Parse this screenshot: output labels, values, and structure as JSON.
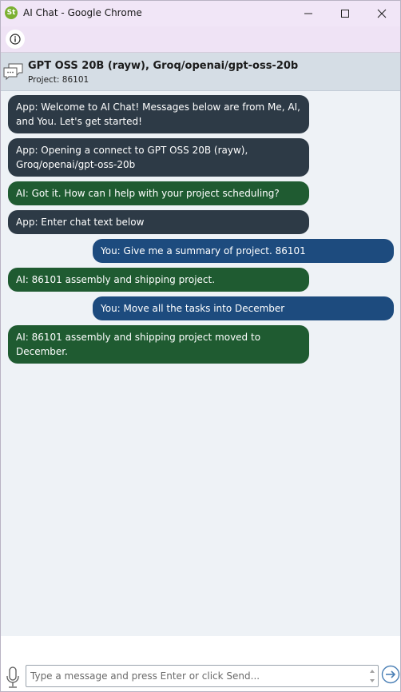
{
  "window": {
    "title": "AI Chat - Google Chrome",
    "app_icon_text": "St"
  },
  "header": {
    "title": "GPT OSS 20B (rayw), Groq/openai/gpt-oss-20b",
    "subtitle": "Project: 86101"
  },
  "messages": [
    {
      "sender": "app",
      "text": "App: Welcome to AI Chat! Messages below are from Me, AI, and You. Let's get started!"
    },
    {
      "sender": "app",
      "text": "App: Opening a connect to GPT OSS 20B (rayw), Groq/openai/gpt-oss-20b"
    },
    {
      "sender": "ai",
      "text": "AI: Got it. How can I help with your project scheduling?"
    },
    {
      "sender": "app",
      "text": "App: Enter chat text below"
    },
    {
      "sender": "you",
      "text": "You: Give me a summary of project. 86101"
    },
    {
      "sender": "ai",
      "text": "AI: 86101 assembly and shipping project."
    },
    {
      "sender": "you",
      "text": "You: Move all the tasks into December"
    },
    {
      "sender": "ai",
      "text": "AI: 86101 assembly and shipping project moved to December."
    }
  ],
  "input": {
    "placeholder": "Type a message and press Enter or click Send...",
    "value": ""
  },
  "colors": {
    "app_bubble": "#2d3a46",
    "ai_bubble": "#1f5b31",
    "you_bubble": "#1d4b7e",
    "titlebar": "#f1e6f7",
    "header": "#d5dde5"
  },
  "icons": {
    "app": "st-logo-icon",
    "minimize": "minimize-icon",
    "maximize": "maximize-icon",
    "close": "close-icon",
    "info": "info-icon",
    "chat": "chat-bubbles-icon",
    "mic": "microphone-icon",
    "send": "send-arrow-icon"
  }
}
